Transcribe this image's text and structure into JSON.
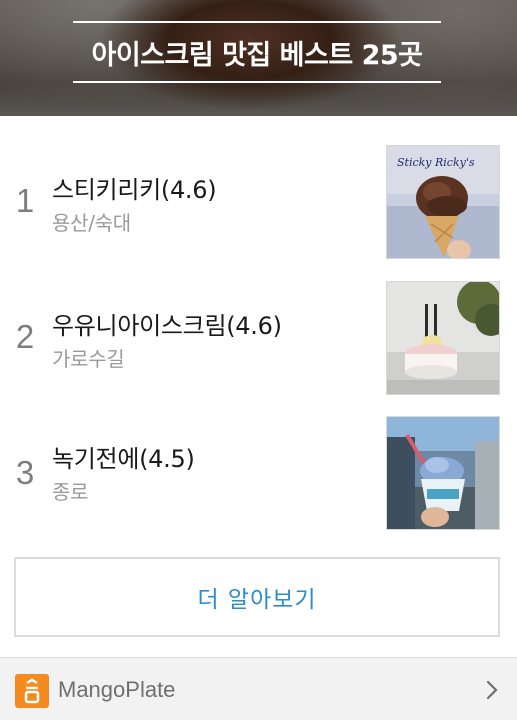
{
  "banner": {
    "title": "아이스크림 맛집 베스트 25곳"
  },
  "list": [
    {
      "rank": "1",
      "name": "스티키리키(4.6)",
      "area": "용산/숙대"
    },
    {
      "rank": "2",
      "name": "우유니아이스크림(4.6)",
      "area": "가로수길"
    },
    {
      "rank": "3",
      "name": "녹기전에(4.5)",
      "area": "종로"
    }
  ],
  "thumbs": {
    "sticky_sign": "Sticky Ricky's"
  },
  "more_button": {
    "label": "더 알아보기"
  },
  "footer": {
    "brand": "MangoPlate",
    "accent_color": "#f58a1f",
    "link_color": "#2a8ec9"
  },
  "icons": {
    "logo": "mangoplate-logo-icon",
    "chevron": "chevron-right-icon"
  }
}
